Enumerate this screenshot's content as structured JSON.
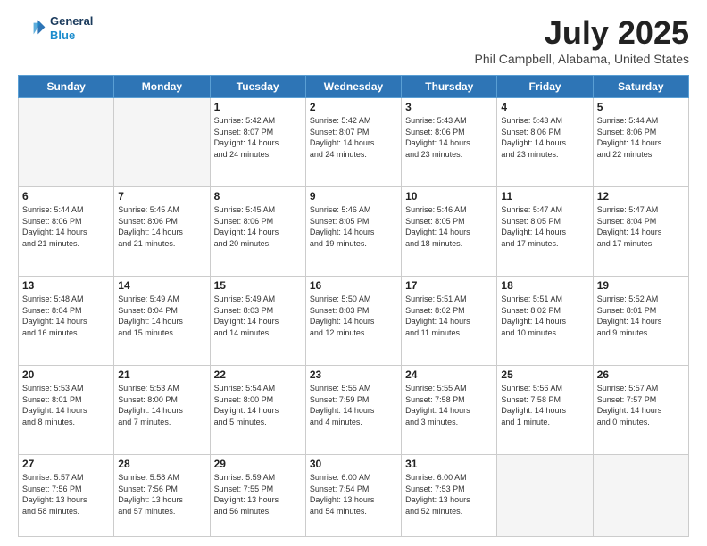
{
  "header": {
    "logo_line1": "General",
    "logo_line2": "Blue",
    "title": "July 2025",
    "location": "Phil Campbell, Alabama, United States"
  },
  "days_of_week": [
    "Sunday",
    "Monday",
    "Tuesday",
    "Wednesday",
    "Thursday",
    "Friday",
    "Saturday"
  ],
  "weeks": [
    [
      {
        "day": "",
        "info": ""
      },
      {
        "day": "",
        "info": ""
      },
      {
        "day": "1",
        "info": "Sunrise: 5:42 AM\nSunset: 8:07 PM\nDaylight: 14 hours\nand 24 minutes."
      },
      {
        "day": "2",
        "info": "Sunrise: 5:42 AM\nSunset: 8:07 PM\nDaylight: 14 hours\nand 24 minutes."
      },
      {
        "day": "3",
        "info": "Sunrise: 5:43 AM\nSunset: 8:06 PM\nDaylight: 14 hours\nand 23 minutes."
      },
      {
        "day": "4",
        "info": "Sunrise: 5:43 AM\nSunset: 8:06 PM\nDaylight: 14 hours\nand 23 minutes."
      },
      {
        "day": "5",
        "info": "Sunrise: 5:44 AM\nSunset: 8:06 PM\nDaylight: 14 hours\nand 22 minutes."
      }
    ],
    [
      {
        "day": "6",
        "info": "Sunrise: 5:44 AM\nSunset: 8:06 PM\nDaylight: 14 hours\nand 21 minutes."
      },
      {
        "day": "7",
        "info": "Sunrise: 5:45 AM\nSunset: 8:06 PM\nDaylight: 14 hours\nand 21 minutes."
      },
      {
        "day": "8",
        "info": "Sunrise: 5:45 AM\nSunset: 8:06 PM\nDaylight: 14 hours\nand 20 minutes."
      },
      {
        "day": "9",
        "info": "Sunrise: 5:46 AM\nSunset: 8:05 PM\nDaylight: 14 hours\nand 19 minutes."
      },
      {
        "day": "10",
        "info": "Sunrise: 5:46 AM\nSunset: 8:05 PM\nDaylight: 14 hours\nand 18 minutes."
      },
      {
        "day": "11",
        "info": "Sunrise: 5:47 AM\nSunset: 8:05 PM\nDaylight: 14 hours\nand 17 minutes."
      },
      {
        "day": "12",
        "info": "Sunrise: 5:47 AM\nSunset: 8:04 PM\nDaylight: 14 hours\nand 17 minutes."
      }
    ],
    [
      {
        "day": "13",
        "info": "Sunrise: 5:48 AM\nSunset: 8:04 PM\nDaylight: 14 hours\nand 16 minutes."
      },
      {
        "day": "14",
        "info": "Sunrise: 5:49 AM\nSunset: 8:04 PM\nDaylight: 14 hours\nand 15 minutes."
      },
      {
        "day": "15",
        "info": "Sunrise: 5:49 AM\nSunset: 8:03 PM\nDaylight: 14 hours\nand 14 minutes."
      },
      {
        "day": "16",
        "info": "Sunrise: 5:50 AM\nSunset: 8:03 PM\nDaylight: 14 hours\nand 12 minutes."
      },
      {
        "day": "17",
        "info": "Sunrise: 5:51 AM\nSunset: 8:02 PM\nDaylight: 14 hours\nand 11 minutes."
      },
      {
        "day": "18",
        "info": "Sunrise: 5:51 AM\nSunset: 8:02 PM\nDaylight: 14 hours\nand 10 minutes."
      },
      {
        "day": "19",
        "info": "Sunrise: 5:52 AM\nSunset: 8:01 PM\nDaylight: 14 hours\nand 9 minutes."
      }
    ],
    [
      {
        "day": "20",
        "info": "Sunrise: 5:53 AM\nSunset: 8:01 PM\nDaylight: 14 hours\nand 8 minutes."
      },
      {
        "day": "21",
        "info": "Sunrise: 5:53 AM\nSunset: 8:00 PM\nDaylight: 14 hours\nand 7 minutes."
      },
      {
        "day": "22",
        "info": "Sunrise: 5:54 AM\nSunset: 8:00 PM\nDaylight: 14 hours\nand 5 minutes."
      },
      {
        "day": "23",
        "info": "Sunrise: 5:55 AM\nSunset: 7:59 PM\nDaylight: 14 hours\nand 4 minutes."
      },
      {
        "day": "24",
        "info": "Sunrise: 5:55 AM\nSunset: 7:58 PM\nDaylight: 14 hours\nand 3 minutes."
      },
      {
        "day": "25",
        "info": "Sunrise: 5:56 AM\nSunset: 7:58 PM\nDaylight: 14 hours\nand 1 minute."
      },
      {
        "day": "26",
        "info": "Sunrise: 5:57 AM\nSunset: 7:57 PM\nDaylight: 14 hours\nand 0 minutes."
      }
    ],
    [
      {
        "day": "27",
        "info": "Sunrise: 5:57 AM\nSunset: 7:56 PM\nDaylight: 13 hours\nand 58 minutes."
      },
      {
        "day": "28",
        "info": "Sunrise: 5:58 AM\nSunset: 7:56 PM\nDaylight: 13 hours\nand 57 minutes."
      },
      {
        "day": "29",
        "info": "Sunrise: 5:59 AM\nSunset: 7:55 PM\nDaylight: 13 hours\nand 56 minutes."
      },
      {
        "day": "30",
        "info": "Sunrise: 6:00 AM\nSunset: 7:54 PM\nDaylight: 13 hours\nand 54 minutes."
      },
      {
        "day": "31",
        "info": "Sunrise: 6:00 AM\nSunset: 7:53 PM\nDaylight: 13 hours\nand 52 minutes."
      },
      {
        "day": "",
        "info": ""
      },
      {
        "day": "",
        "info": ""
      }
    ]
  ]
}
